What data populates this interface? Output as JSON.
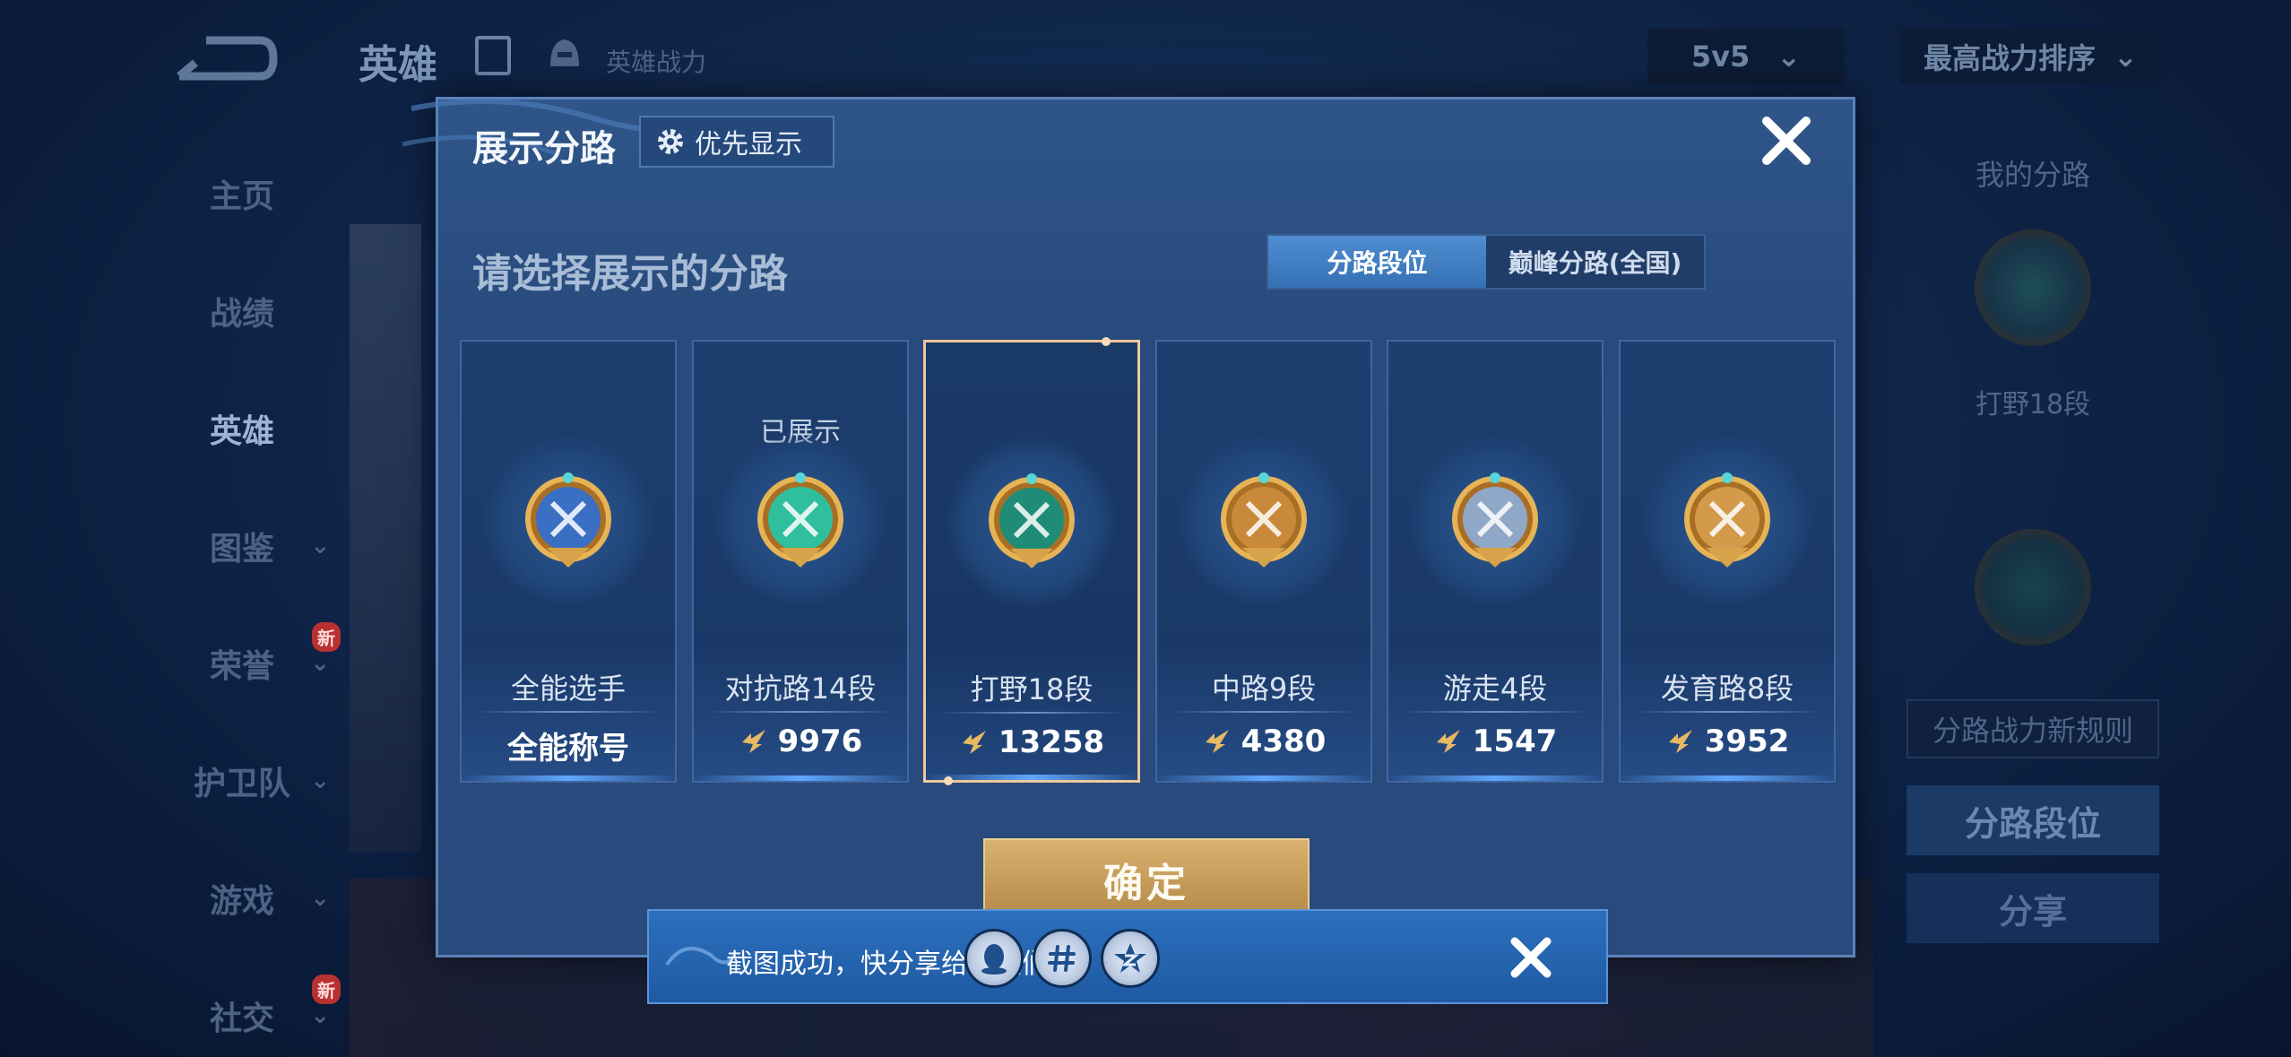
{
  "background": {
    "app_title": "英雄",
    "power_label": "英雄战力",
    "mode_select": "5v5",
    "sort_select": "最高战力排序",
    "nav": [
      {
        "label": "主页",
        "new": ""
      },
      {
        "label": "战绩",
        "new": ""
      },
      {
        "label": "英雄",
        "new": ""
      },
      {
        "label": "图鉴",
        "new": ""
      },
      {
        "label": "荣誉",
        "new": "新"
      },
      {
        "label": "护卫队",
        "new": ""
      },
      {
        "label": "游戏",
        "new": ""
      },
      {
        "label": "社交",
        "new": "新"
      }
    ],
    "right_panel": {
      "title": "我的分路",
      "lane_label": "打野18段",
      "rule_button": "分路战力新规则",
      "rank_button": "分路段位",
      "share_button": "分享"
    }
  },
  "modal": {
    "title": "展示分路",
    "priority_button": "优先显示",
    "subtitle": "请选择展示的分路",
    "tabs": [
      {
        "label": "分路段位",
        "active": true
      },
      {
        "label": "巅峰分路(全国)",
        "active": false
      }
    ],
    "cards": [
      {
        "name": "全能选手",
        "value": "全能称号",
        "shown": "",
        "selected": false,
        "color": "#3b6fc4"
      },
      {
        "name": "对抗路14段",
        "value": "9976",
        "shown": "已展示",
        "selected": false,
        "color": "#2fbf9c"
      },
      {
        "name": "打野18段",
        "value": "13258",
        "shown": "",
        "selected": true,
        "color": "#1f8c78"
      },
      {
        "name": "中路9段",
        "value": "4380",
        "shown": "",
        "selected": false,
        "color": "#c9893a"
      },
      {
        "name": "游走4段",
        "value": "1547",
        "shown": "",
        "selected": false,
        "color": "#8fa8c8"
      },
      {
        "name": "发育路8段",
        "value": "3952",
        "shown": "",
        "selected": false,
        "color": "#d29a4a"
      }
    ],
    "confirm_button": "确定"
  },
  "toast": {
    "text": "截图成功，快分享给朋友们吧!",
    "share_targets": [
      "qq-icon",
      "hashtag-icon",
      "qzone-icon"
    ]
  }
}
